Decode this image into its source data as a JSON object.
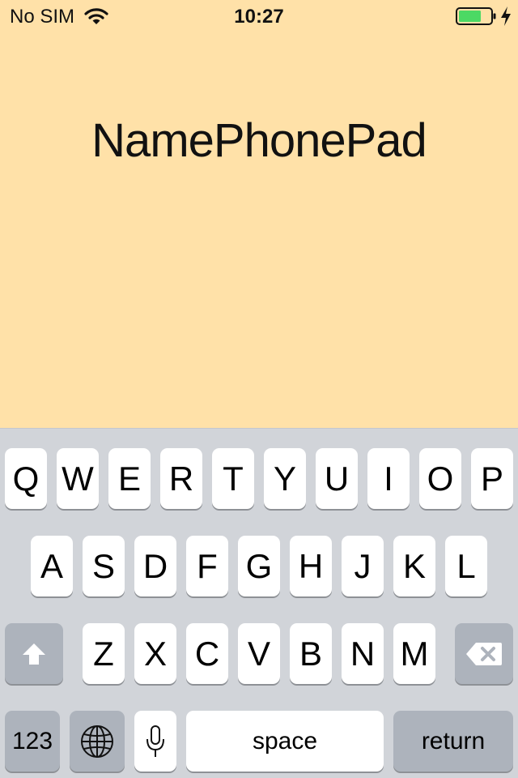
{
  "status_bar": {
    "carrier": "No SIM",
    "time": "10:27",
    "battery_color": "#4CD964",
    "icons": [
      "wifi-icon",
      "battery-icon",
      "charging-icon"
    ]
  },
  "main": {
    "title": "NamePhonePad",
    "background": "#FFE1A8"
  },
  "keyboard": {
    "row1": [
      "Q",
      "W",
      "E",
      "R",
      "T",
      "Y",
      "U",
      "I",
      "O",
      "P"
    ],
    "row2": [
      "A",
      "S",
      "D",
      "F",
      "G",
      "H",
      "J",
      "K",
      "L"
    ],
    "row3": [
      "Z",
      "X",
      "C",
      "V",
      "B",
      "N",
      "M"
    ],
    "numbers_label": "123",
    "space_label": "space",
    "return_label": "return",
    "function_icons": [
      "shift-icon",
      "delete-icon",
      "globe-icon",
      "microphone-icon"
    ]
  }
}
